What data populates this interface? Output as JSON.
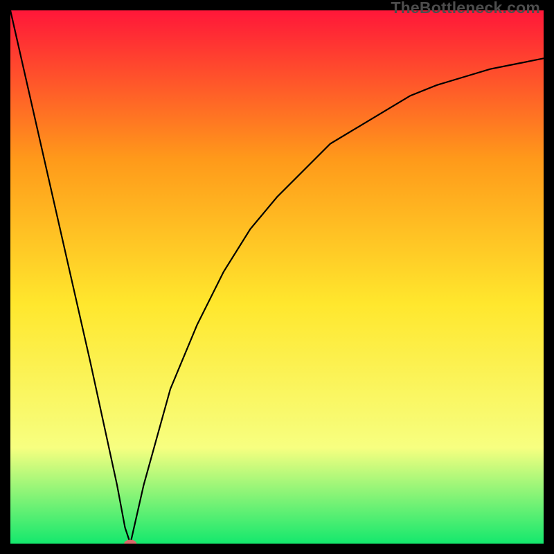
{
  "watermark": "TheBottleneck.com",
  "chart_data": {
    "type": "line",
    "title": "",
    "xlabel": "",
    "ylabel": "",
    "xlim": [
      0,
      100
    ],
    "ylim": [
      0,
      100
    ],
    "gradient_colors": {
      "top": "#ff1739",
      "upper_mid": "#ff9a1a",
      "mid": "#ffe72d",
      "lower_mid": "#f7ff80",
      "bottom": "#14e86d"
    },
    "series": [
      {
        "name": "curve",
        "x": [
          0,
          5,
          10,
          15,
          20,
          21.5,
          22.5,
          25,
          30,
          35,
          40,
          45,
          50,
          55,
          60,
          65,
          70,
          75,
          80,
          85,
          90,
          95,
          100
        ],
        "y": [
          100,
          78,
          56,
          34,
          11,
          3,
          0,
          11,
          29,
          41,
          51,
          59,
          65,
          70,
          75,
          78,
          81,
          84,
          86,
          87.5,
          89,
          90,
          91
        ]
      }
    ],
    "marker": {
      "x": 22.5,
      "y": 0,
      "color": "#d86a6a"
    }
  }
}
